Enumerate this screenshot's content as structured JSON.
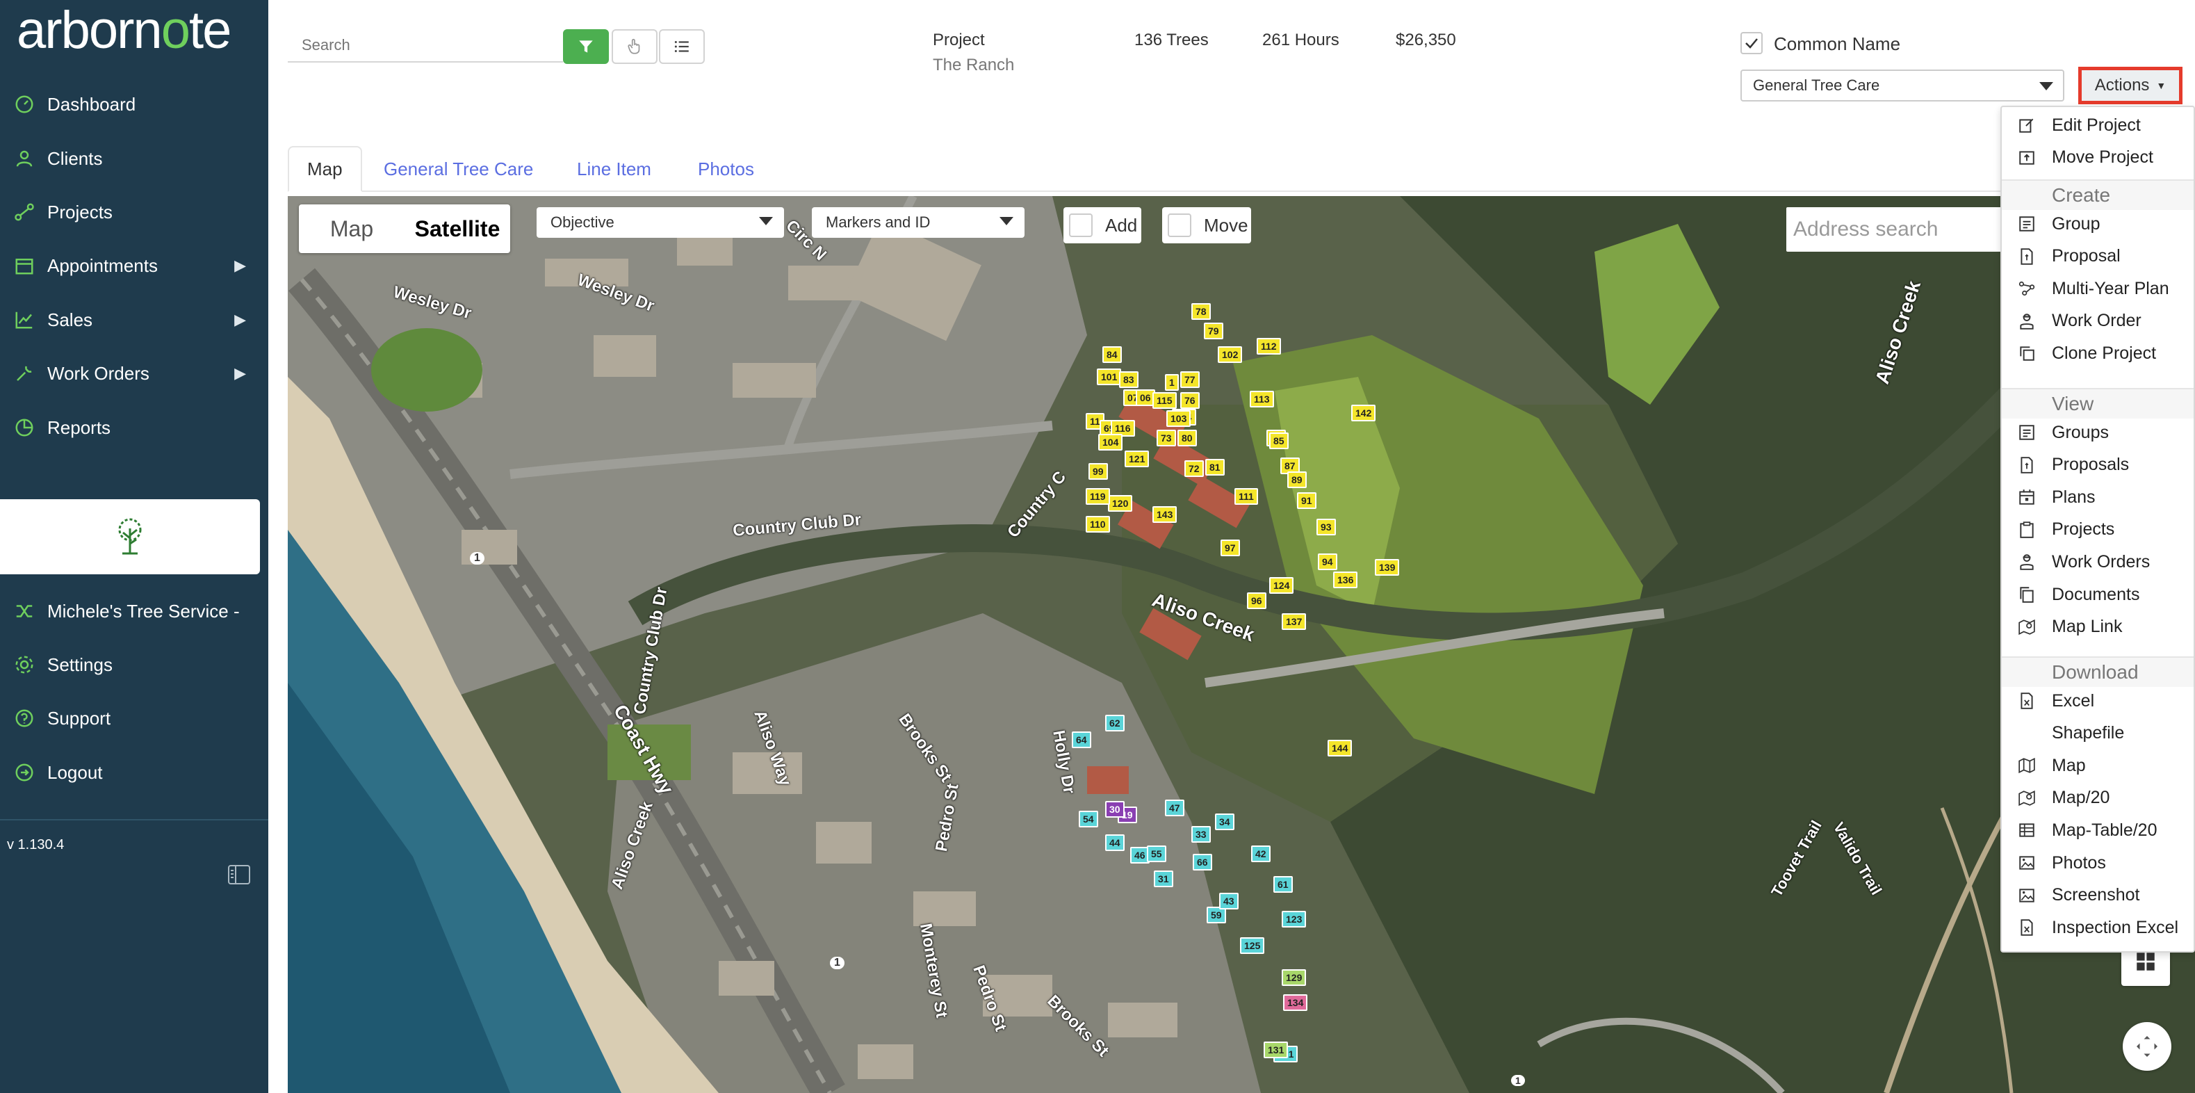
{
  "app": {
    "logo_text_1": "arborn",
    "logo_leaf": "o",
    "logo_text_2": "te",
    "version": "v 1.130.4"
  },
  "sidebar": {
    "items": [
      {
        "label": "Dashboard",
        "icon": "dashboard-icon"
      },
      {
        "label": "Clients",
        "icon": "user-icon"
      },
      {
        "label": "Projects",
        "icon": "projects-icon"
      },
      {
        "label": "Appointments",
        "icon": "calendar-icon"
      },
      {
        "label": "Sales",
        "icon": "chart-icon"
      },
      {
        "label": "Work Orders",
        "icon": "wrench-icon"
      },
      {
        "label": "Reports",
        "icon": "pie-icon"
      }
    ],
    "company": "Michele's Tree Service -",
    "bottom": [
      {
        "label": "Settings",
        "icon": "gear-icon"
      },
      {
        "label": "Support",
        "icon": "help-icon"
      },
      {
        "label": "Logout",
        "icon": "logout-icon"
      }
    ]
  },
  "header": {
    "search_placeholder": "Search",
    "project_label": "Project",
    "project_name": "The Ranch",
    "trees": "136 Trees",
    "hours": "261 Hours",
    "amount": "$26,350",
    "common_name": "Common Name",
    "service_select": "General Tree Care",
    "actions": "Actions"
  },
  "tabs": [
    "Map",
    "General Tree Care",
    "Line Item",
    "Photos"
  ],
  "map": {
    "type_map": "Map",
    "type_satellite": "Satellite",
    "objective": "Objective",
    "markers": "Markers and ID",
    "add": "Add",
    "move": "Move",
    "address_placeholder": "Address search",
    "streets": [
      "Wesley Dr",
      "Wesley Dr",
      "Country Club Dr",
      "Country Club Dr",
      "Country C",
      "Aliso Creek",
      "Aliso Creek",
      "Coast Hwy",
      "Aliso Way",
      "Aliso Creek",
      "Brooks St",
      "Pedro St",
      "Holly Dr",
      "Monterey St",
      "Pedro St",
      "Brooks St",
      "Toovet Trail",
      "Valido Trail",
      "Circ N",
      "1",
      "1",
      "1"
    ]
  },
  "menu": {
    "top": [
      {
        "label": "Edit Project",
        "icon": "edit-icon"
      },
      {
        "label": "Move Project",
        "icon": "move-icon"
      }
    ],
    "create_header": "Create",
    "create": [
      {
        "label": "Group",
        "icon": "group-icon"
      },
      {
        "label": "Proposal",
        "icon": "proposal-icon"
      },
      {
        "label": "Multi-Year Plan",
        "icon": "plan-icon"
      },
      {
        "label": "Work Order",
        "icon": "worker-icon"
      },
      {
        "label": "Clone Project",
        "icon": "clone-icon"
      }
    ],
    "view_header": "View",
    "view": [
      {
        "label": "Groups",
        "icon": "group-icon"
      },
      {
        "label": "Proposals",
        "icon": "proposal-icon"
      },
      {
        "label": "Plans",
        "icon": "calendar-icon"
      },
      {
        "label": "Projects",
        "icon": "clipboard-icon"
      },
      {
        "label": "Work Orders",
        "icon": "worker-icon"
      },
      {
        "label": "Documents",
        "icon": "documents-icon"
      },
      {
        "label": "Map Link",
        "icon": "maplink-icon"
      }
    ],
    "download_header": "Download",
    "download": [
      {
        "label": "Excel",
        "icon": "excel-icon"
      },
      {
        "label": "Shapefile",
        "icon": ""
      },
      {
        "label": "Map",
        "icon": "map-icon"
      },
      {
        "label": "Map/20",
        "icon": "maplink-icon"
      },
      {
        "label": "Map-Table/20",
        "icon": "table-icon"
      },
      {
        "label": "Photos",
        "icon": "image-icon"
      },
      {
        "label": "Screenshot",
        "icon": "image-icon"
      },
      {
        "label": "Inspection Excel",
        "icon": "excel-icon"
      }
    ]
  },
  "colors": {
    "sidebar": "#1f3b4d",
    "accent": "#4caf50",
    "link": "#5b6ee1",
    "highlight": "#e53b2c"
  },
  "markers": {
    "yellow": [
      "78",
      "79",
      "84",
      "102",
      "112",
      "101",
      "83",
      "07",
      "06",
      "115",
      "76",
      "1",
      "77",
      "11",
      "69",
      "116",
      "104",
      "114",
      "113",
      "73",
      "80",
      "16",
      "103",
      "85",
      "121",
      "72",
      "81",
      "87",
      "89",
      "120",
      "110",
      "143",
      "111",
      "91",
      "93",
      "97",
      "94",
      "136",
      "139",
      "124",
      "96",
      "137",
      "142",
      "119",
      "99",
      "144"
    ],
    "cyan": [
      "64",
      "62",
      "54",
      "47",
      "44",
      "46",
      "55",
      "33",
      "34",
      "31",
      "66",
      "42",
      "61",
      "59",
      "43",
      "123",
      "125",
      "131"
    ],
    "purple": [
      "19",
      "30"
    ],
    "green": [
      "129",
      "131"
    ],
    "pink": [
      "134"
    ]
  }
}
